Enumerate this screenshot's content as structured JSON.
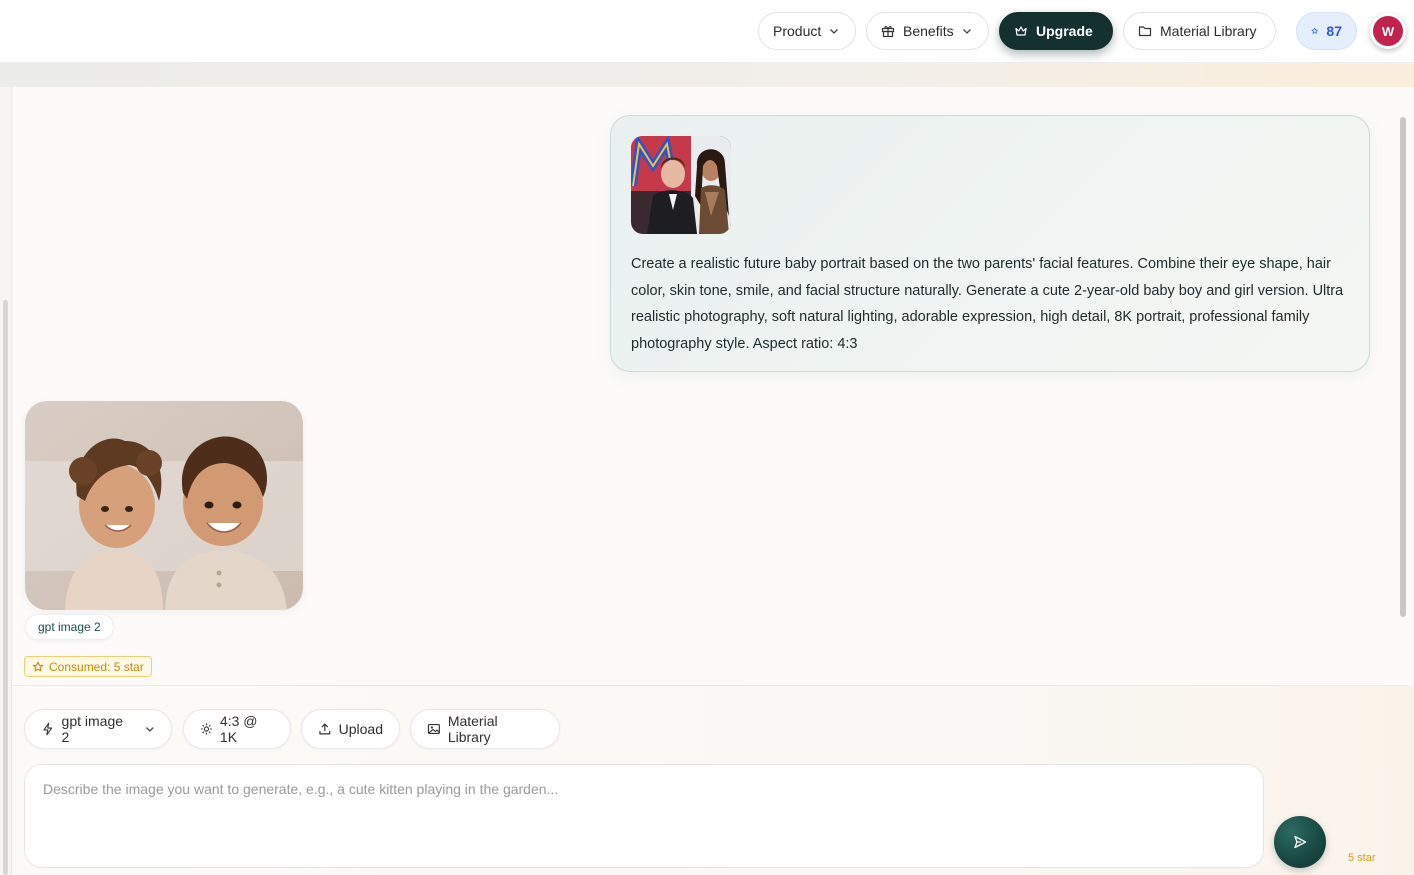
{
  "header": {
    "product_label": "Product",
    "benefits_label": "Benefits",
    "upgrade_label": "Upgrade",
    "library_label": "Material Library",
    "stars_count": "87",
    "avatar_initial": "W"
  },
  "chat": {
    "user_message": {
      "prompt": "Create a realistic future baby portrait based on the two parents' facial features. Combine their eye shape, hair color, skin tone, smile, and facial structure naturally. Generate a cute 2-year-old baby boy and girl version. Ultra realistic photography, soft natural lighting, adorable expression, high detail, 8K portrait, professional family photography style. Aspect ratio: 4:3"
    },
    "result": {
      "model_tag": "gpt image 2",
      "consumed_label": "Consumed: 5 star"
    }
  },
  "composer": {
    "model_chip": "gpt image 2",
    "ratio_chip": "4:3 @ 1K",
    "upload_chip": "Upload",
    "library_chip": "Material Library",
    "placeholder": "Describe the image you want to generate, e.g., a cute kitten playing in the garden...",
    "cost_label": "5 star"
  },
  "colors": {
    "accent_dark": "#14302f",
    "star_blue": "#2d5ad6",
    "avatar": "#c0234e",
    "consumed_gold": "#c98a06"
  },
  "icons": [
    "chevron-down-icon",
    "gift-icon",
    "crown-icon",
    "folder-icon",
    "star-icon",
    "lightning-icon",
    "gear-icon",
    "upload-icon",
    "image-icon",
    "send-icon"
  ]
}
